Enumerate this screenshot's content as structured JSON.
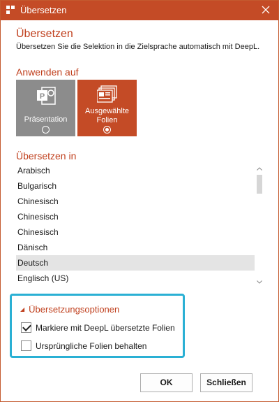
{
  "window": {
    "title": "Übersetzen",
    "accent_color": "#c44b26",
    "app_icon": "deepl-logo-icon",
    "close_icon": "close-icon"
  },
  "header": {
    "heading": "Übersetzen",
    "description": "Übersetzen Sie die Selektion in die Zielsprache automatisch mit DeepL."
  },
  "apply_section": {
    "heading": "Anwenden auf",
    "options": [
      {
        "label": "Präsentation",
        "icon": "powerpoint-icon",
        "selected": false
      },
      {
        "label_line1": "Ausgewählte",
        "label_line2": "Folien",
        "icon": "slides-icon",
        "selected": true
      }
    ]
  },
  "translate_section": {
    "heading": "Übersetzen in",
    "languages": [
      "Arabisch",
      "Bulgarisch",
      "Chinesisch",
      "Chinesisch",
      "Chinesisch",
      "Dänisch",
      "Deutsch",
      "Englisch (US)"
    ],
    "selected": "Deutsch"
  },
  "options_section": {
    "heading": "Übersetzungsoptionen",
    "highlight_color": "#2ab0d4",
    "checkboxes": [
      {
        "label": "Markiere mit DeepL übersetzte Folien",
        "checked": true
      },
      {
        "label": "Ursprüngliche Folien behalten",
        "checked": false
      }
    ]
  },
  "buttons": {
    "ok": "OK",
    "close": "Schließen"
  }
}
